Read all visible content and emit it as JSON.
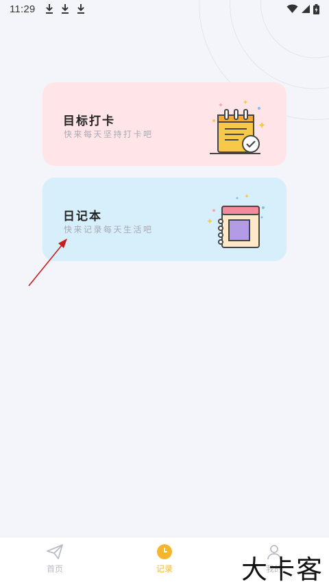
{
  "status_bar": {
    "time": "11:29",
    "download_icons": [
      "download-icon",
      "download-icon",
      "download-icon"
    ],
    "right_icons": [
      "wifi-icon",
      "signal-icon",
      "battery-icon"
    ]
  },
  "cards": [
    {
      "title": "目标打卡",
      "subtitle": "快来每天坚持打卡吧",
      "icon": "clipboard-check-icon",
      "color": "#ffe5e7"
    },
    {
      "title": "日记本",
      "subtitle": "快来记录每天生活吧",
      "icon": "notebook-icon",
      "color": "#d7eefb"
    }
  ],
  "bottom_nav": {
    "items": [
      {
        "label": "首页",
        "icon": "paper-plane-icon",
        "active": false
      },
      {
        "label": "记录",
        "icon": "clock-icon",
        "active": true,
        "color": "#f5b62f"
      },
      {
        "label": "我的",
        "icon": "user-icon",
        "active": false
      }
    ]
  },
  "watermark": "大卡客",
  "colors": {
    "accent": "#f5b62f",
    "annotation_arrow": "#c81d1d"
  }
}
